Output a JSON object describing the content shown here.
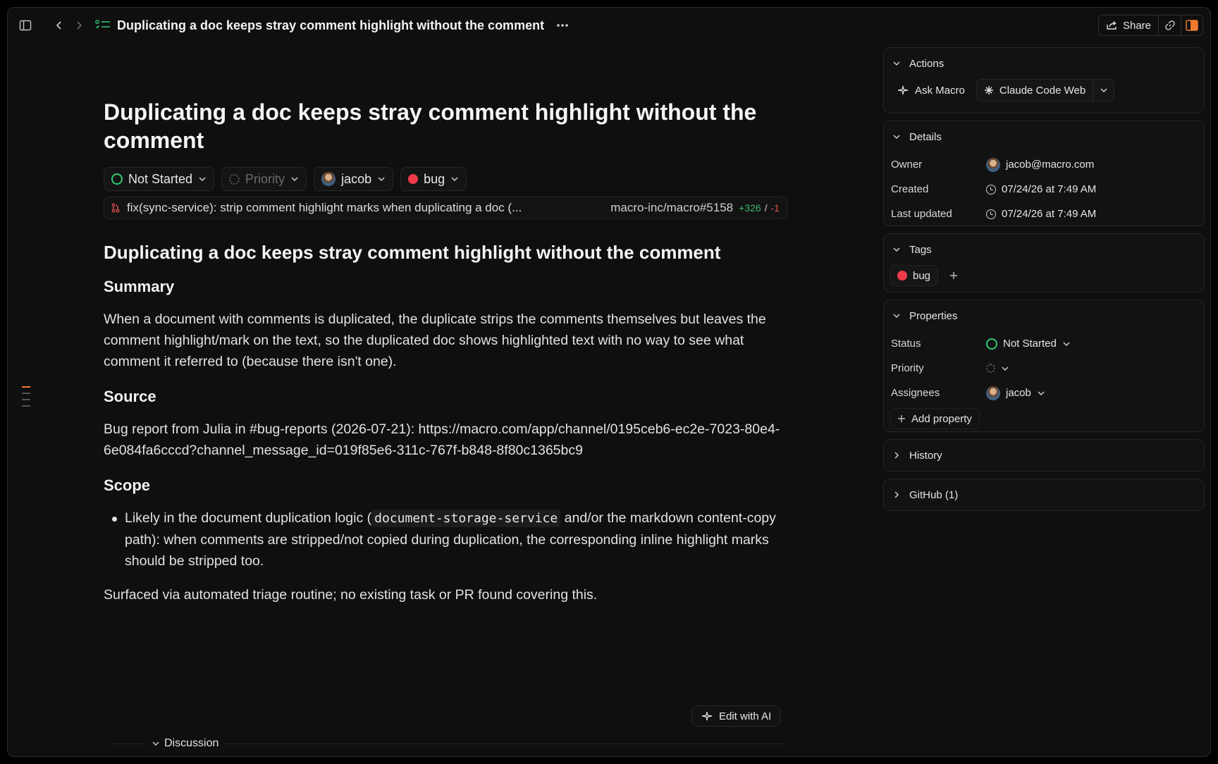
{
  "topbar": {
    "title": "Duplicating a doc keeps stray comment highlight without the comment",
    "share_label": "Share",
    "accent_color": "#f07a2e"
  },
  "doc": {
    "title": "Duplicating a doc keeps stray comment highlight without the comment",
    "chips": {
      "status": "Not Started",
      "priority": "Priority",
      "assignee": "jacob",
      "tag": "bug"
    },
    "pr": {
      "title": "fix(sync-service): strip comment highlight marks when duplicating a doc (...",
      "ref": "macro-inc/macro#5158",
      "additions": "+326",
      "separator": "/",
      "deletions": "-1"
    },
    "heading": "Duplicating a doc keeps stray comment highlight without the comment",
    "summary_heading": "Summary",
    "summary_text": "When a document with comments is duplicated, the duplicate strips the comments themselves but leaves the comment highlight/mark on the text, so the duplicated doc shows highlighted text with no way to see what comment it referred to (because there isn't one).",
    "source_heading": "Source",
    "source_text": "Bug report from Julia in #bug-reports (2026-07-21): https://macro.com/app/channel/0195ceb6-ec2e-7023-80e4-6e084fa6cccd?channel_message_id=019f85e6-311c-767f-b848-8f80c1365bc9",
    "scope_heading": "Scope",
    "scope_bullet_pre": "Likely in the document duplication logic (",
    "scope_bullet_code": "document-storage-service",
    "scope_bullet_post": " and/or the markdown content-copy path): when comments are stripped/not copied during duplication, the corresponding inline highlight marks should be stripped too.",
    "footer_text": "Surfaced via automated triage routine; no existing task or PR found covering this.",
    "edit_ai_label": "Edit with AI",
    "discussion_label": "Discussion"
  },
  "panel": {
    "actions": {
      "title": "Actions",
      "ask_macro": "Ask Macro",
      "claude_code_web": "Claude Code Web"
    },
    "details": {
      "title": "Details",
      "owner_label": "Owner",
      "owner_value": "jacob@macro.com",
      "created_label": "Created",
      "created_value": "07/24/26 at 7:49 AM",
      "updated_label": "Last updated",
      "updated_value": "07/24/26 at 7:49 AM"
    },
    "tags": {
      "title": "Tags",
      "tag": "bug",
      "tag_color": "#ef3a4a"
    },
    "properties": {
      "title": "Properties",
      "status_label": "Status",
      "status_value": "Not Started",
      "status_color": "#2ecc71",
      "priority_label": "Priority",
      "assignees_label": "Assignees",
      "assignees_value": "jacob",
      "add_property": "Add property"
    },
    "history": {
      "title": "History"
    },
    "github": {
      "title": "GitHub (1)"
    }
  }
}
